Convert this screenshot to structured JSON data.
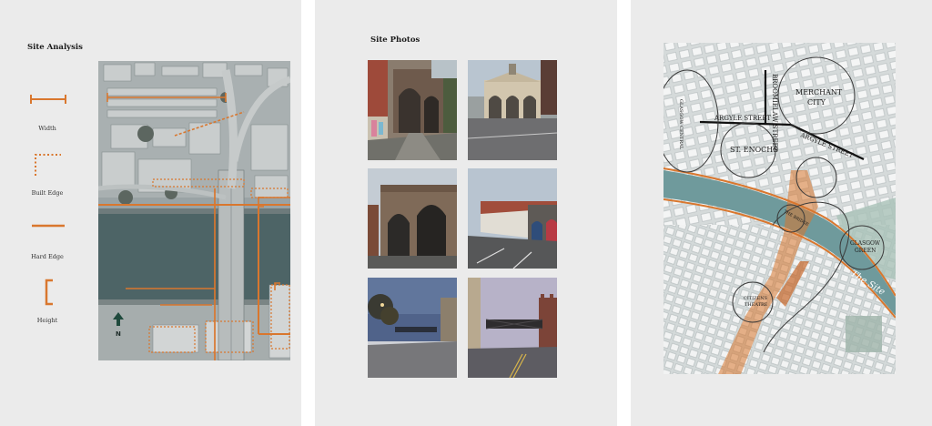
{
  "panels": {
    "site_analysis": {
      "title": "Site Analysis",
      "legend": [
        {
          "label": "Width",
          "icon": "width-line-icon"
        },
        {
          "label": "Built Edge",
          "icon": "built-edge-dotted-icon"
        },
        {
          "label": "Hard Edge",
          "icon": "hard-edge-line-icon"
        },
        {
          "label": "Height",
          "icon": "height-bracket-icon"
        }
      ],
      "north_label": "N"
    },
    "site_photos": {
      "title": "Site Photos",
      "photos": [
        {
          "icon": "railway-arch-alley-photo"
        },
        {
          "icon": "stone-pavilion-photo"
        },
        {
          "icon": "arched-viaduct-photo"
        },
        {
          "icon": "brick-arches-street-photo"
        },
        {
          "icon": "riverside-walkway-dusk-photo"
        },
        {
          "icon": "rail-bridge-street-photo"
        }
      ]
    },
    "context_map": {
      "streets": {
        "argyle_a": "ARGYLE STREET",
        "argyle_b": "ARGYLE STREET",
        "broomielaw": "BROOMIELAW STREET"
      },
      "districts": {
        "glasgow_central": "GLASGOW CENTRAL",
        "merchant_city_1": "MERCHANT",
        "merchant_city_2": "CITY",
        "st_enochs": "ST. ENOCHS",
        "the_bridge": "THE BRIDGE",
        "glasgow_green_1": "GLASGOW",
        "glasgow_green_2": "GREEN",
        "citizens_theatre_1": "CITIZENS",
        "citizens_theatre_2": "THEATRE",
        "the_site": "The Site"
      }
    }
  },
  "colors": {
    "accent_orange": "#d9772e",
    "river": "#6f9a9c",
    "panel_bg": "#ebebeb"
  }
}
